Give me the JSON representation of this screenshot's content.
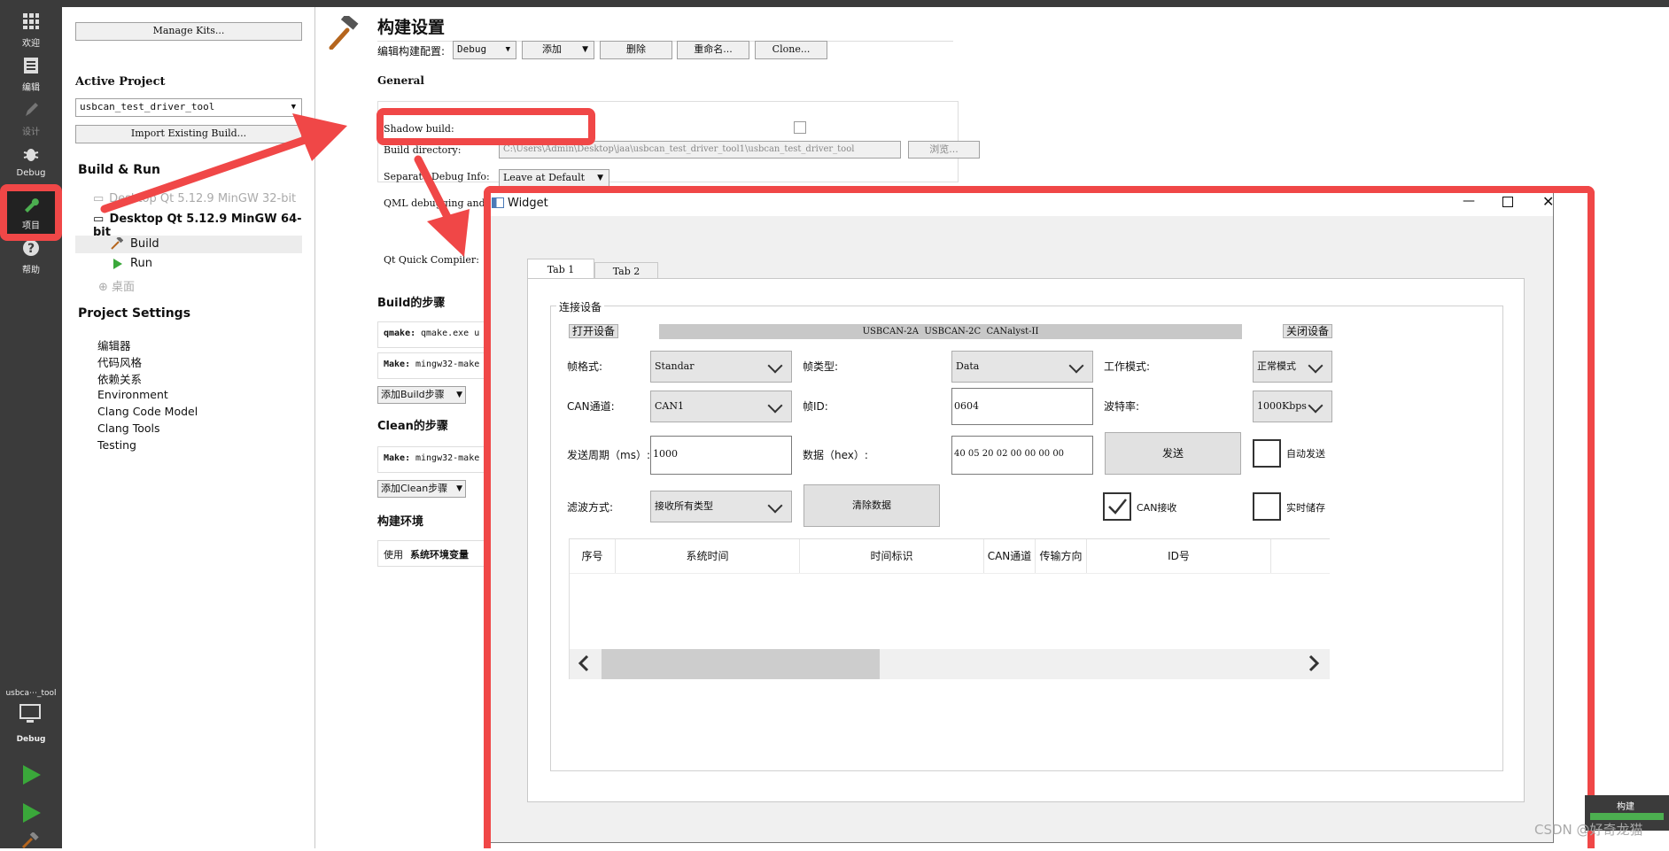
{
  "modebar": {
    "modes": [
      {
        "label": "欢迎",
        "icon": "grid-icon"
      },
      {
        "label": "编辑",
        "icon": "document-icon"
      },
      {
        "label": "设计",
        "icon": "pen-icon"
      },
      {
        "label": "Debug",
        "icon": "bug-icon"
      },
      {
        "label": "项目",
        "icon": "wrench-icon"
      },
      {
        "label": "帮助",
        "icon": "help-icon"
      }
    ],
    "kit_label": "usbca⋯_tool",
    "kit_mode": "Debug",
    "build_icon_label": "构建"
  },
  "nav": {
    "manage_kits": "Manage Kits...",
    "active_project_heading": "Active Project",
    "active_project_value": "usbcan_test_driver_tool",
    "import_build": "Import Existing Build...",
    "build_run_heading": "Build & Run",
    "kit_32": "Desktop Qt 5.12.9 MinGW 32-bit",
    "kit_64": "Desktop Qt 5.12.9 MinGW 64-bit",
    "build": "Build",
    "run": "Run",
    "desktop": "桌面",
    "project_settings_heading": "Project Settings",
    "settings": [
      "编辑器",
      "代码风格",
      "依赖关系",
      "Environment",
      "Clang Code Model",
      "Clang Tools",
      "Testing"
    ]
  },
  "main": {
    "title": "构建设置",
    "edit_config_label": "编辑构建配置:",
    "config_value": "Debug",
    "add": "添加",
    "delete": "删除",
    "rename": "重命名...",
    "clone": "Clone...",
    "general": "General",
    "shadow_build": "Shadow build:",
    "build_directory": "Build directory:",
    "build_directory_value": "C:\\Users\\Admin\\Desktop\\jaa\\usbcan_test_driver_tool1\\usbcan_test_driver_tool",
    "browse": "浏览...",
    "separate_debug": "Separate Debug Info:",
    "separate_debug_value": "Leave at Default",
    "qml_debugging": "QML debugging and",
    "qt_quick_compiler": "Qt Quick Compiler:",
    "build_steps": "Build的步骤",
    "qmake_step_label": "qmake:",
    "qmake_step_value": "qmake.exe u",
    "make_step_label": "Make:",
    "make_step_value": "mingw32-make",
    "add_build_step": "添加Build步骤",
    "clean_steps": "Clean的步骤",
    "clean_make_label": "Make:",
    "clean_make_value": "mingw32-make",
    "add_clean_step": "添加Clean步骤",
    "build_env": "构建环境",
    "use_label": "使用",
    "system_env": "系统环境变量"
  },
  "widget": {
    "title": "Widget",
    "tab1": "Tab 1",
    "tab2": "Tab 2",
    "group_title": "连接设备",
    "open_device": "打开设备",
    "device_list": "USBCAN-2A  USBCAN-2C  CANalyst-II",
    "close_device": "关闭设备",
    "frame_format_label": "帧格式:",
    "frame_format_value": "Standar",
    "frame_type_label": "帧类型:",
    "frame_type_value": "Data",
    "work_mode_label": "工作模式:",
    "work_mode_value": "正常模式",
    "can_channel_label": "CAN通道:",
    "can_channel_value": "CAN1",
    "frame_id_label": "帧ID:",
    "frame_id_value": "0604",
    "baud_label": "波特率:",
    "baud_value": "1000Kbps",
    "period_label": "发送周期（ms）:",
    "period_value": "1000",
    "data_label": "数据（hex）:",
    "data_value": "40 05 20 02 00 00 00 00",
    "send": "发送",
    "auto_send": "自动发送",
    "filter_label": "滤波方式:",
    "filter_value": "接收所有类型",
    "clear_data": "清除数据",
    "can_receive": "CAN接收",
    "realtime_save": "实时储存",
    "columns": [
      "序号",
      "系统时间",
      "时间标识",
      "CAN通道",
      "传输方向",
      "ID号"
    ]
  },
  "watermark": "CSDN @好奇龙猫",
  "colors": {
    "highlight": "#f04747",
    "modebar": "#3b3b3b",
    "run_green": "#3aa83a"
  }
}
